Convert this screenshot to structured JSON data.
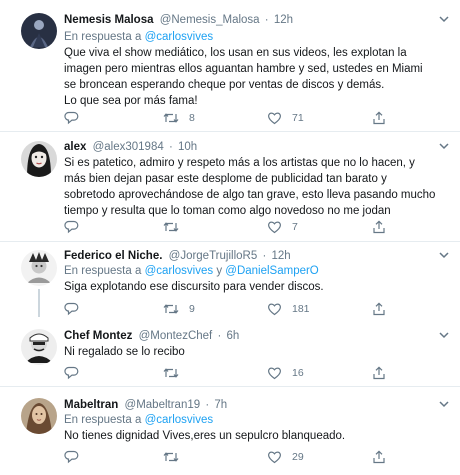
{
  "tweets": [
    {
      "name": "Nemesis Malosa",
      "handle": "@Nemesis_Malosa",
      "time": "12h",
      "reply_prefix": "En respuesta a ",
      "reply_to": "@carlosvives",
      "text": "Que viva el show mediático, los usan en sus videos, les explotan la imagen pero mientras ellos aguantan hambre y sed, ustedes en Miami se broncean esperando cheque por ventas de discos y demás.\nLo que sea por más fama!",
      "replies": "",
      "retweets": "8",
      "likes": "71"
    },
    {
      "name": "alex",
      "handle": "@alex301984",
      "time": "10h",
      "text": "Si es patetico, admiro y respeto más a los artistas que no lo hacen, y más bien dejan pasar este desplome de publicidad tan barato y sobretodo aprovechándose de algo tan grave, esto lleva pasando mucho tiempo y resulta que lo toman como algo novedoso no me jodan",
      "replies": "",
      "retweets": "",
      "likes": "7"
    },
    {
      "name": "Federico el Niche.",
      "handle": "@JorgeTrujilloR5",
      "time": "12h",
      "reply_prefix": "En respuesta a ",
      "reply_to": "@carlosvives",
      "reply_joiner": " y ",
      "reply_to_2": "@DanielSamperO",
      "text": "Siga explotando ese discursito para vender discos.",
      "replies": "",
      "retweets": "9",
      "likes": "181"
    },
    {
      "name": "Chef Montez",
      "handle": "@MontezChef",
      "time": "6h",
      "text": "Ni regalado se lo recibo",
      "replies": "",
      "retweets": "",
      "likes": "16"
    },
    {
      "name": "Mabeltran",
      "handle": "@Mabeltran19",
      "time": "7h",
      "reply_prefix": "En respuesta a ",
      "reply_to": "@carlosvives",
      "text": "No tienes dignidad Vives,eres un sepulcro blanqueado.",
      "replies": "",
      "retweets": "",
      "likes": "29"
    }
  ],
  "icons": {
    "reply": "reply-icon",
    "retweet": "retweet-icon",
    "like": "heart-icon",
    "share": "share-icon",
    "menu": "chevron-down-icon"
  },
  "colors": {
    "link": "#1da1f2",
    "muted": "#657786",
    "text": "#14171a",
    "divider": "#e6ecf0",
    "thread_line": "#ccd6dd"
  }
}
